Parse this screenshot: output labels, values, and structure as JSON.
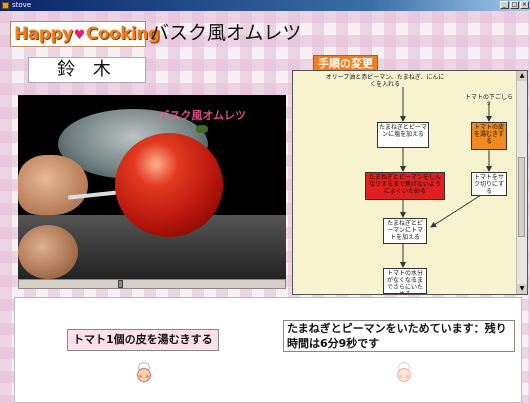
{
  "window": {
    "title": "stove",
    "controls": [
      "_",
      "□",
      "×"
    ]
  },
  "header": {
    "logo_text_1": "Happy",
    "logo_heart": "♥",
    "logo_text_2": "Cooking",
    "recipe_title": "バスク風オムレツ",
    "user_name": "鈴 木",
    "steps_label": "手順の変更"
  },
  "video": {
    "overlay_text": "バスク風オムレツ",
    "progress": 0.38
  },
  "flowchart": {
    "nodes": [
      {
        "id": "n1",
        "text": "オリーブ油と赤ピーマン、たまねぎ、にんにくを入れる",
        "color": "white"
      },
      {
        "id": "n2",
        "text": "たまねぎとピーマンに塩を加える",
        "color": "white"
      },
      {
        "id": "n3",
        "text": "たまねぎとピーマンをしんなりするまで焦げないようによくいためる",
        "color": "red"
      },
      {
        "id": "n4",
        "text": "たまねぎとピーマンにトマトを加える",
        "color": "white"
      },
      {
        "id": "n5",
        "text": "トマトの水分がなくなるまでさらにいためる",
        "color": "white"
      },
      {
        "id": "s1",
        "text": "トマトの下ごしらえ",
        "color": "none"
      },
      {
        "id": "s2",
        "text": "トマトの皮を湯むきする",
        "color": "orange"
      },
      {
        "id": "s3",
        "text": "トマトをサク切りにする",
        "color": "white"
      }
    ]
  },
  "bottom": {
    "left_message": "トマト1個の皮を湯むきする",
    "right_message": "たまねぎとピーマンをいためています：残り時間は6分9秒です"
  },
  "colors": {
    "accent_orange": "#f07e1e",
    "heart_pink": "#e0206a",
    "active_red": "#e02020",
    "flow_bg": "#f8f3cf"
  }
}
